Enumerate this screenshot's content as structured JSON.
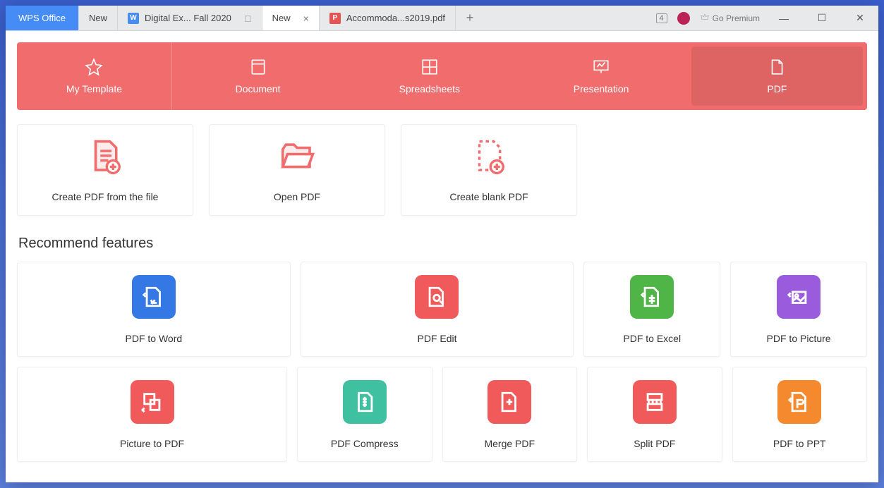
{
  "titlebar": {
    "app_label": "WPS Office",
    "tabs": [
      {
        "label": "New",
        "icon": "",
        "color": ""
      },
      {
        "label": "Digital Ex... Fall 2020",
        "icon": "W",
        "color": "#4a8df0",
        "aux": "◻"
      },
      {
        "label": "New",
        "icon": "",
        "color": "",
        "active": true,
        "close": true
      },
      {
        "label": "Accommoda...s2019.pdf",
        "icon": "P",
        "color": "#e55353"
      }
    ],
    "add": "+",
    "doc_count": "4",
    "premium_label": "Go Premium",
    "win_min": "—",
    "win_max": "☐",
    "win_close": "✕"
  },
  "hero": {
    "items": [
      {
        "label": "My Template"
      },
      {
        "label": "Document"
      },
      {
        "label": "Spreadsheets"
      },
      {
        "label": "Presentation"
      },
      {
        "label": "PDF",
        "active": true
      }
    ]
  },
  "quick_actions": [
    {
      "label": "Create PDF from the file"
    },
    {
      "label": "Open PDF"
    },
    {
      "label": "Create blank PDF"
    }
  ],
  "section_title": "Recommend features",
  "features_row1": [
    {
      "label": "PDF to Word",
      "color": "#3478e5"
    },
    {
      "label": "PDF Edit",
      "color": "#f05a5a"
    },
    {
      "label": "PDF to Excel",
      "color": "#4fb547"
    },
    {
      "label": "PDF to Picture",
      "color": "#9a5cdc"
    }
  ],
  "features_row2": [
    {
      "label": "Picture to PDF",
      "color": "#f05a5a"
    },
    {
      "label": "PDF Compress",
      "color": "#3fc1a1"
    },
    {
      "label": "Merge PDF",
      "color": "#f05a5a"
    },
    {
      "label": "Split PDF",
      "color": "#f05a5a"
    },
    {
      "label": "PDF to PPT",
      "color": "#f5892e"
    }
  ]
}
